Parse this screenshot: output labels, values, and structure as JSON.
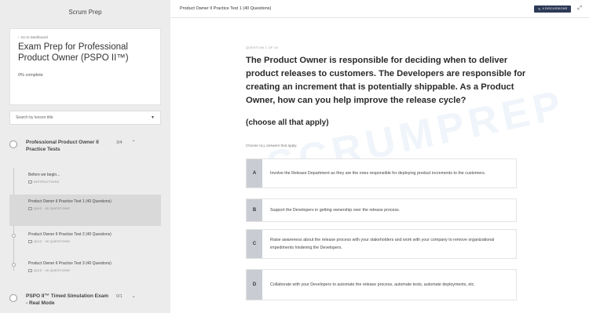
{
  "sidebar": {
    "brand": "Scrum Prep",
    "back_link": "Go to Dashboard",
    "course_title": "Exam Prep for Professional Product Owner (PSPO II™)",
    "progress": "0% complete",
    "search_placeholder": "Search by lesson title",
    "sections": [
      {
        "title": "Professional Product Owner II Practice Tests",
        "count": "3/4"
      },
      {
        "title": "PSPO II™ Timed Simulation Exam - Real Mode",
        "count": "0/1"
      }
    ],
    "lessons": [
      {
        "title": "Before we begin...",
        "meta": "INSTRUCTIONS"
      },
      {
        "title": "Product Owner II Practice Test 1 (40 Questions)",
        "meta": "QUIZ · 40 QUESTIONS"
      },
      {
        "title": "Product Owner II Practice Test 2 (40 Questions)",
        "meta": "QUIZ · 40 QUESTIONS"
      },
      {
        "title": "Product Owner II Practice Test 3 (40 Questions)",
        "meta": "QUIZ · 40 QUESTIONS"
      }
    ]
  },
  "topbar": {
    "title": "Product Owner II Practice Test 1 (40 Questions)",
    "discussions": "4 DISCUSSIONS"
  },
  "question": {
    "number": "QUESTION 1 OF 40",
    "text": "The Product Owner is responsible for deciding when to deliver product releases to customers. The Developers are responsible for creating an increment that is potentially shippable. As a Product Owner, how can you help improve the release cycle?",
    "choose": "(choose all that apply)",
    "instruction": "Choose ALL answers that apply.",
    "options": [
      {
        "letter": "A",
        "text": "Involve the Release Department as they are the ones responsible for deploying product increments to the customers."
      },
      {
        "letter": "B",
        "text": "Support the Developers in getting ownership over the release process."
      },
      {
        "letter": "C",
        "text": "Raise awareness about the release process with your stakeholders and work with your company to remove organizational impediments hindering the Developers."
      },
      {
        "letter": "D",
        "text": "Collaborate with your Developers to automate the release process, automate tests, automate deployments, etc."
      }
    ]
  },
  "watermark": "SCRUMPREP",
  "colors": {
    "discussion_button": "#2d3a57",
    "option_letter_bg": "#c9cdd3",
    "active_lesson_bg": "#d9d9d9"
  }
}
